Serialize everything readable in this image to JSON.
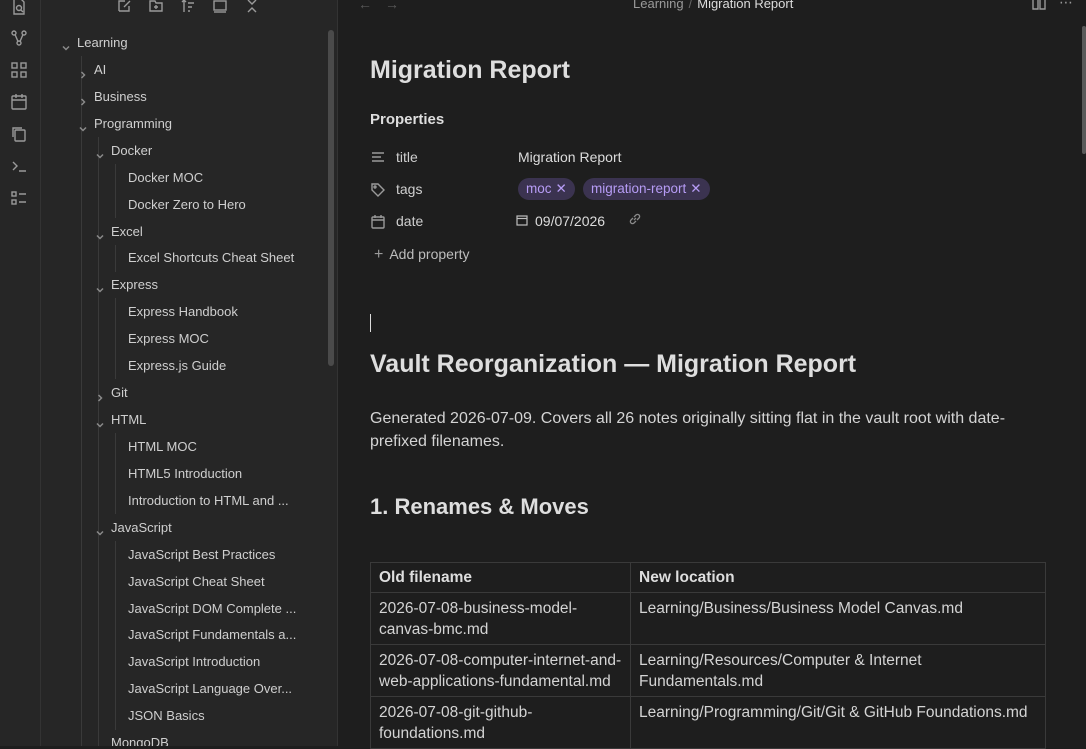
{
  "ribbon": {
    "icons": [
      "file-search-icon",
      "graph-icon",
      "blocks-icon",
      "calendar-icon",
      "copy-icon",
      "terminal-icon",
      "list-checks-icon"
    ]
  },
  "sidebar_toolbar": {
    "icons": [
      "new-note-icon",
      "new-folder-icon",
      "sort-icon",
      "collapse-view-icon",
      "collapse-all-icon"
    ]
  },
  "file_tree": [
    {
      "label": "Learning",
      "type": "folder",
      "open": true,
      "depth": 0
    },
    {
      "label": "AI",
      "type": "folder",
      "open": false,
      "depth": 1
    },
    {
      "label": "Business",
      "type": "folder",
      "open": false,
      "depth": 1
    },
    {
      "label": "Programming",
      "type": "folder",
      "open": true,
      "depth": 1
    },
    {
      "label": "Docker",
      "type": "folder",
      "open": true,
      "depth": 2
    },
    {
      "label": "Docker MOC",
      "type": "file",
      "depth": 3
    },
    {
      "label": "Docker Zero to Hero",
      "type": "file",
      "depth": 3
    },
    {
      "label": "Excel",
      "type": "folder",
      "open": true,
      "depth": 2
    },
    {
      "label": "Excel Shortcuts Cheat Sheet",
      "type": "file",
      "depth": 3
    },
    {
      "label": "Express",
      "type": "folder",
      "open": true,
      "depth": 2
    },
    {
      "label": "Express Handbook",
      "type": "file",
      "depth": 3
    },
    {
      "label": "Express MOC",
      "type": "file",
      "depth": 3
    },
    {
      "label": "Express.js Guide",
      "type": "file",
      "depth": 3
    },
    {
      "label": "Git",
      "type": "folder",
      "open": false,
      "depth": 2
    },
    {
      "label": "HTML",
      "type": "folder",
      "open": true,
      "depth": 2
    },
    {
      "label": "HTML MOC",
      "type": "file",
      "depth": 3
    },
    {
      "label": "HTML5 Introduction",
      "type": "file",
      "depth": 3
    },
    {
      "label": "Introduction to HTML and ...",
      "type": "file",
      "depth": 3
    },
    {
      "label": "JavaScript",
      "type": "folder",
      "open": true,
      "depth": 2
    },
    {
      "label": "JavaScript Best Practices",
      "type": "file",
      "depth": 3
    },
    {
      "label": "JavaScript Cheat Sheet",
      "type": "file",
      "depth": 3
    },
    {
      "label": "JavaScript DOM Complete ...",
      "type": "file",
      "depth": 3
    },
    {
      "label": "JavaScript Fundamentals a...",
      "type": "file",
      "depth": 3
    },
    {
      "label": "JavaScript Introduction",
      "type": "file",
      "depth": 3
    },
    {
      "label": "JavaScript Language Over...",
      "type": "file",
      "depth": 3
    },
    {
      "label": "JSON Basics",
      "type": "file",
      "depth": 3
    },
    {
      "label": "MongoDB",
      "type": "folder",
      "open": true,
      "depth": 2
    }
  ],
  "breadcrumb": {
    "parent": "Learning",
    "separator": "/",
    "current": "Migration Report"
  },
  "note": {
    "title": "Migration Report",
    "properties_heading": "Properties",
    "properties": {
      "title": {
        "name": "title",
        "value": "Migration Report"
      },
      "tags": {
        "name": "tags",
        "values": [
          "moc",
          "migration-report"
        ]
      },
      "date": {
        "name": "date",
        "value": "09/07/2026"
      }
    },
    "add_property": "Add property",
    "heading1": "Vault Reorganization — Migration Report",
    "paragraph": "Generated 2026-07-09. Covers all 26 notes originally sitting flat in the vault root with date-prefixed filenames.",
    "heading2": "1. Renames & Moves",
    "table": {
      "headers": [
        "Old filename",
        "New location"
      ],
      "rows": [
        [
          "2026-07-08-business-model-canvas-bmc.md",
          "Learning/Business/Business Model Canvas.md"
        ],
        [
          "2026-07-08-computer-internet-and-web-applications-fundamental.md",
          "Learning/Resources/Computer & Internet Fundamentals.md"
        ],
        [
          "2026-07-08-git-github-foundations.md",
          "Learning/Programming/Git/Git & GitHub Foundations.md"
        ]
      ]
    }
  }
}
